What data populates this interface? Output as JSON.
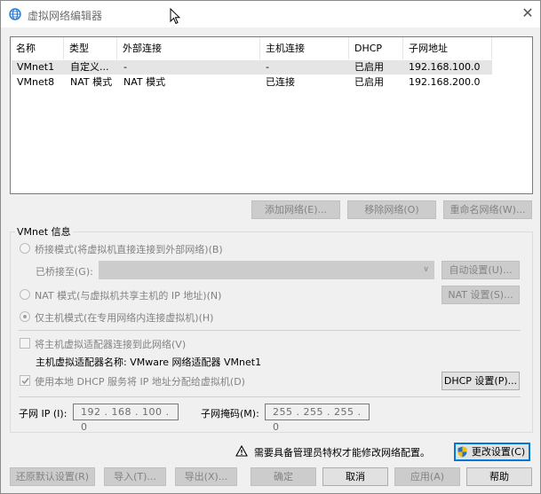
{
  "window": {
    "title": "虚拟网络编辑器",
    "close_glyph": "✕"
  },
  "table": {
    "headers": [
      "名称",
      "类型",
      "外部连接",
      "主机连接",
      "DHCP",
      "子网地址"
    ],
    "rows": [
      [
        "VMnet1",
        "自定义...",
        "-",
        "-",
        "已启用",
        "192.168.100.0"
      ],
      [
        "VMnet8",
        "NAT 模式",
        "NAT 模式",
        "已连接",
        "已启用",
        "192.168.200.0"
      ]
    ]
  },
  "table_buttons": {
    "add": "添加网络(E)...",
    "remove": "移除网络(O)",
    "rename": "重命名网络(W)..."
  },
  "vmnet_info": {
    "group_label": "VMnet 信息",
    "bridged_label": "桥接模式(将虚拟机直接连接到外部网络)(B)",
    "bridged_to_label": "已桥接至(G):",
    "bridged_to_value": "",
    "auto_settings": "自动设置(U)...",
    "nat_label": "NAT 模式(与虚拟机共享主机的 IP 地址)(N)",
    "nat_settings": "NAT 设置(S)...",
    "host_only_label": "仅主机模式(在专用网络内连接虚拟机)(H)",
    "connect_adapter_label": "将主机虚拟适配器连接到此网络(V)",
    "adapter_name_label": "主机虚拟适配器名称: VMware 网络适配器 VMnet1",
    "use_dhcp_label": "使用本地 DHCP 服务将 IP 地址分配给虚拟机(D)",
    "dhcp_settings": "DHCP 设置(P)...",
    "subnet_ip_label": "子网 IP (I):",
    "subnet_ip_value": "192 . 168 . 100 .  0",
    "subnet_mask_label": "子网掩码(M):",
    "subnet_mask_value": "255 . 255 . 255 .  0",
    "selected_mode": "host-only",
    "connect_adapter_checked": false,
    "use_dhcp_checked": true
  },
  "admin_notice": {
    "text": "需要具备管理员特权才能修改网络配置。",
    "change_settings": "更改设置(C)"
  },
  "footer": {
    "restore_defaults": "还原默认设置(R)",
    "import": "导入(T)...",
    "export": "导出(X)...",
    "ok": "确定",
    "cancel": "取消",
    "apply": "应用(A)",
    "help": "帮助"
  },
  "colors": {
    "accent": "#0078d7",
    "selected_row": "#e5e5e5",
    "disabled_text": "#838383",
    "warning": "#000000"
  },
  "icons": [
    "network-globe-icon",
    "mouse-cursor-icon",
    "warning-icon",
    "uac-shield-icon",
    "chevron-down-icon"
  ]
}
